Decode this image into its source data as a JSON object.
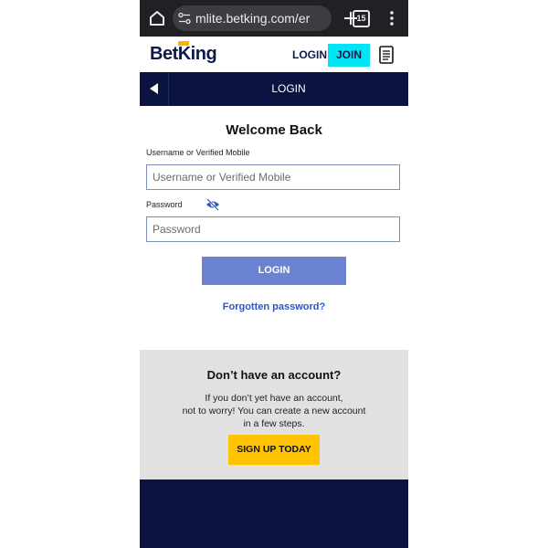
{
  "browser": {
    "url": "mlite.betking.com/er",
    "tab_count": "15",
    "icons": [
      "home-icon",
      "site-settings-icon",
      "plus-icon",
      "tabs-icon",
      "overflow-menu-icon"
    ]
  },
  "header": {
    "logo_bet": "Bet",
    "logo_king": "King",
    "login_label": "LOGIN",
    "join_label": "JOIN"
  },
  "nav": {
    "title": "LOGIN"
  },
  "form": {
    "welcome": "Welcome Back",
    "username_label": "Username or Verified Mobile",
    "username_placeholder": "Username or Verified Mobile",
    "password_label": "Password",
    "password_placeholder": "Password",
    "login_button": "LOGIN",
    "forgot_link": "Forgotten password?"
  },
  "signup": {
    "title": "Don’t have an account?",
    "line1": "If you don’t yet have an account,",
    "line2": "not to worry! You can create a new account",
    "line3": "in a few steps.",
    "button": "SIGN UP TODAY"
  },
  "colors": {
    "brand_navy": "#0b1340",
    "join_cyan": "#00e5f5",
    "login_blue": "#6a82d0",
    "link_blue": "#2a56c6",
    "signup_yellow": "#ffc400"
  }
}
